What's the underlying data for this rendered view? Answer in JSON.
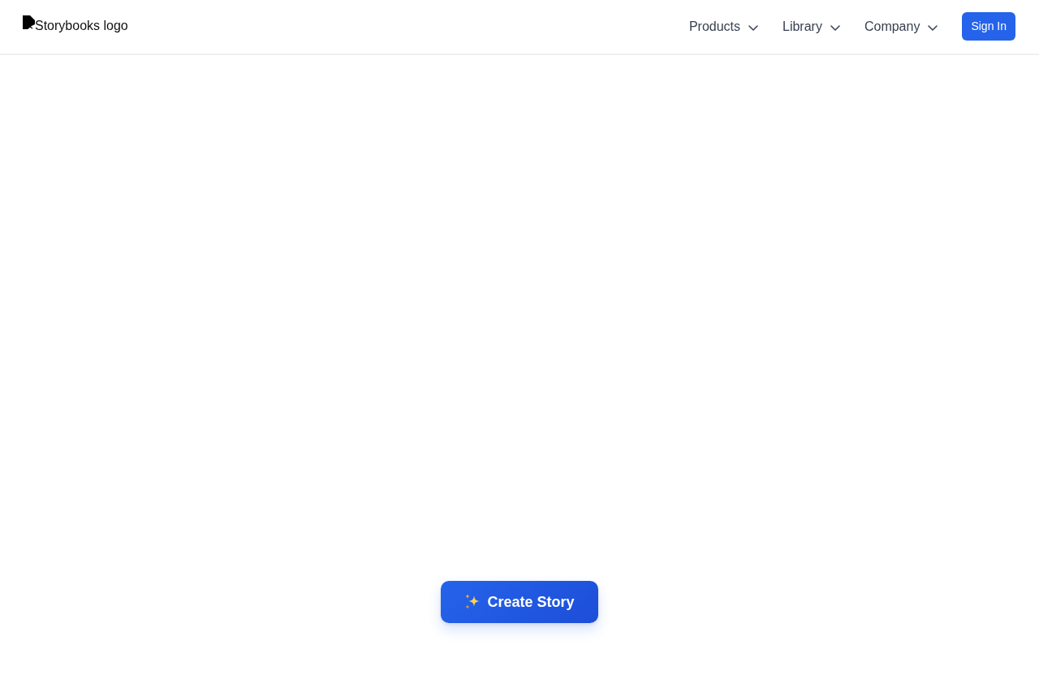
{
  "header": {
    "logo": {
      "alt_text": "Storybooks logo"
    },
    "nav_items": [
      {
        "label": "Products",
        "expanded": false
      },
      {
        "label": "Library",
        "expanded": false
      },
      {
        "label": "Company",
        "expanded": false
      }
    ],
    "sign_in_button": {
      "label": "Sign In"
    }
  },
  "main": {
    "create_button": {
      "label": "Create Story"
    }
  }
}
